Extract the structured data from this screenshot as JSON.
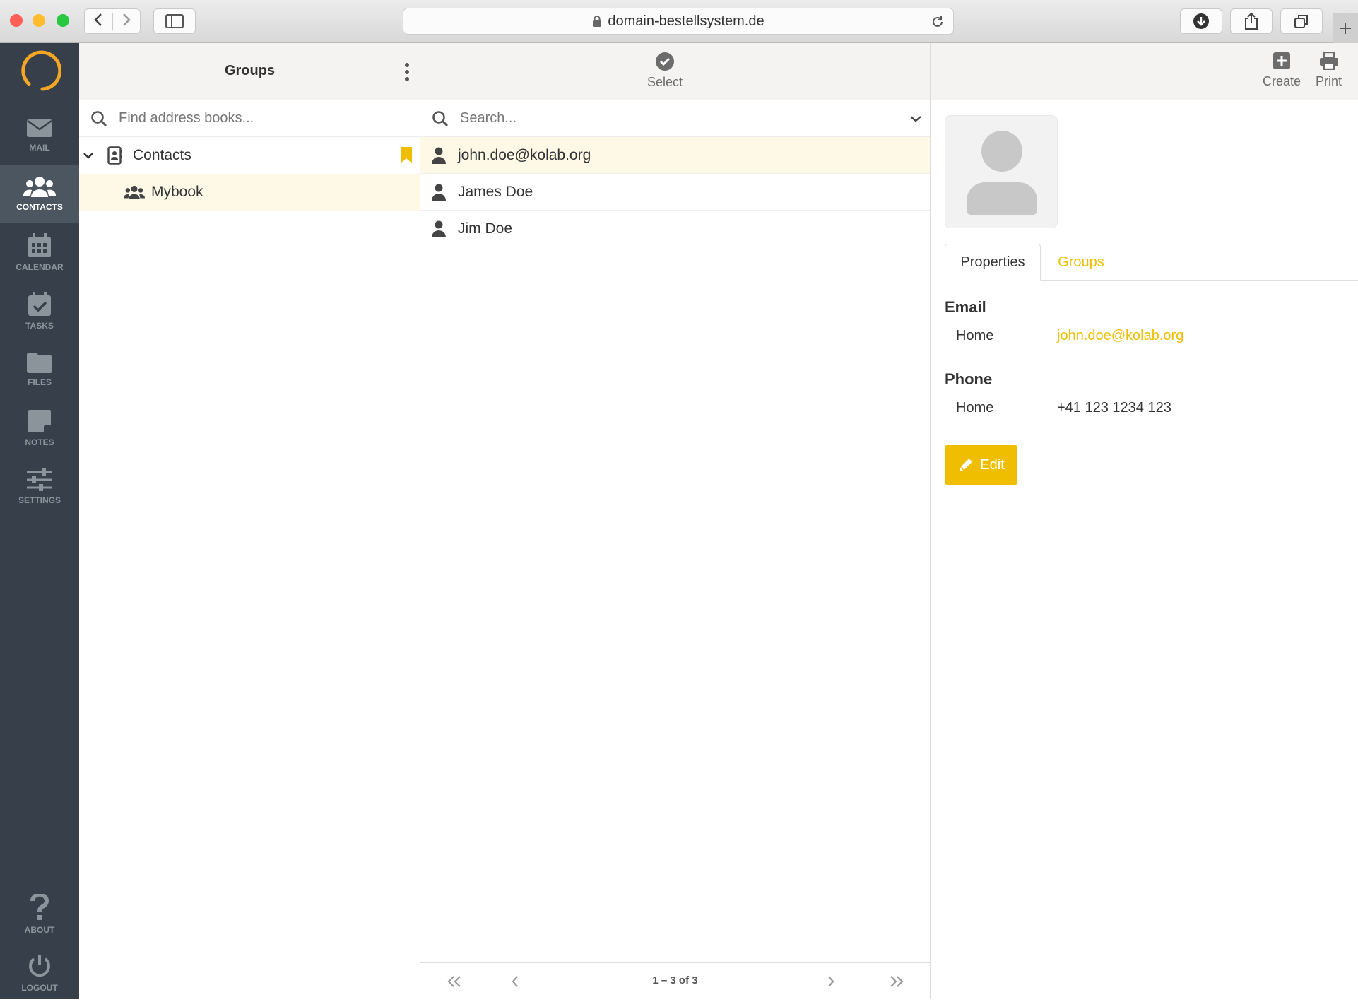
{
  "browser": {
    "url": "domain-bestellsystem.de"
  },
  "nav": {
    "items": [
      {
        "label": "MAIL"
      },
      {
        "label": "CONTACTS"
      },
      {
        "label": "CALENDAR"
      },
      {
        "label": "TASKS"
      },
      {
        "label": "FILES"
      },
      {
        "label": "NOTES"
      },
      {
        "label": "SETTINGS"
      },
      {
        "label": "ABOUT"
      },
      {
        "label": "LOGOUT"
      }
    ],
    "active": "CONTACTS"
  },
  "groups_panel": {
    "title": "Groups",
    "search_placeholder": "Find address books...",
    "addressbook": "Contacts",
    "group": "Mybook"
  },
  "list_panel": {
    "select_label": "Select",
    "search_placeholder": "Search...",
    "contacts": [
      "john.doe@kolab.org",
      "James Doe",
      "Jim Doe"
    ],
    "pagination": "1 – 3 of 3"
  },
  "detail_panel": {
    "toolbar": {
      "create_label": "Create",
      "print_label": "Print"
    },
    "tabs": [
      "Properties",
      "Groups"
    ],
    "email": {
      "heading": "Email",
      "type": "Home",
      "value": "john.doe@kolab.org"
    },
    "phone": {
      "heading": "Phone",
      "type": "Home",
      "value": "+41 123 1234 123"
    },
    "edit_label": "Edit"
  },
  "colors": {
    "accent": "#f0be00",
    "sidebar": "#37404a",
    "selection": "#fdf9e6"
  }
}
